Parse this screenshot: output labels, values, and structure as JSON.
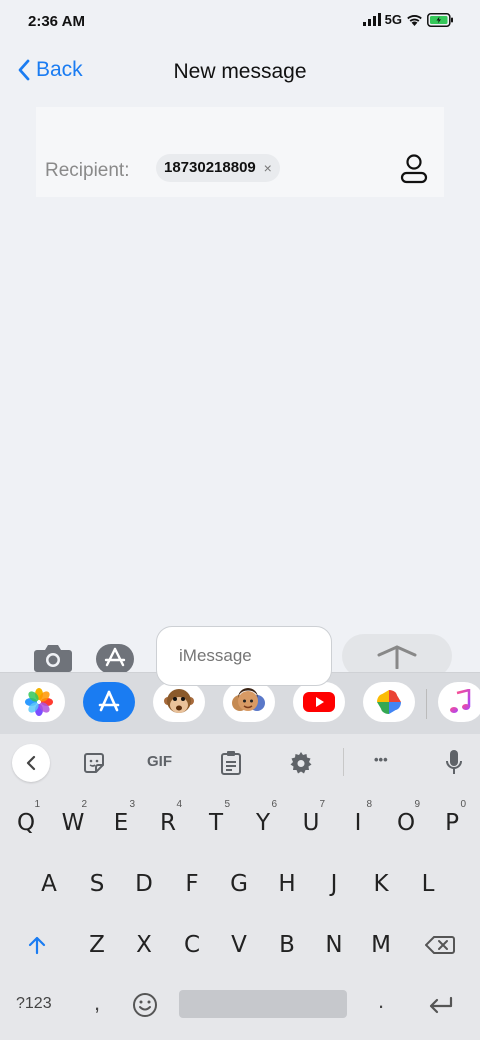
{
  "status_bar": {
    "time": "2:36 AM",
    "network": "5G"
  },
  "nav": {
    "back_label": "Back",
    "title": "New message"
  },
  "recipient": {
    "label": "Recipient:",
    "number": "18730218809",
    "remove": "×"
  },
  "compose": {
    "placeholder": "iMessage"
  },
  "keyboard": {
    "toolbar": {
      "gif": "GIF",
      "more": "•••"
    },
    "row1": [
      {
        "key": "Q",
        "alt": "1"
      },
      {
        "key": "W",
        "alt": "2"
      },
      {
        "key": "E",
        "alt": "3"
      },
      {
        "key": "R",
        "alt": "4"
      },
      {
        "key": "T",
        "alt": "5"
      },
      {
        "key": "Y",
        "alt": "6"
      },
      {
        "key": "U",
        "alt": "7"
      },
      {
        "key": "I",
        "alt": "8"
      },
      {
        "key": "O",
        "alt": "9"
      },
      {
        "key": "P",
        "alt": "0"
      }
    ],
    "row2": [
      "A",
      "S",
      "D",
      "F",
      "G",
      "H",
      "J",
      "K",
      "L"
    ],
    "row3": [
      "Z",
      "X",
      "C",
      "V",
      "B",
      "N",
      "M"
    ],
    "symbols_label": "?123",
    "comma": ",",
    "period": "."
  },
  "colors": {
    "accent": "#1a7cf2",
    "background": "#eff1f5"
  }
}
